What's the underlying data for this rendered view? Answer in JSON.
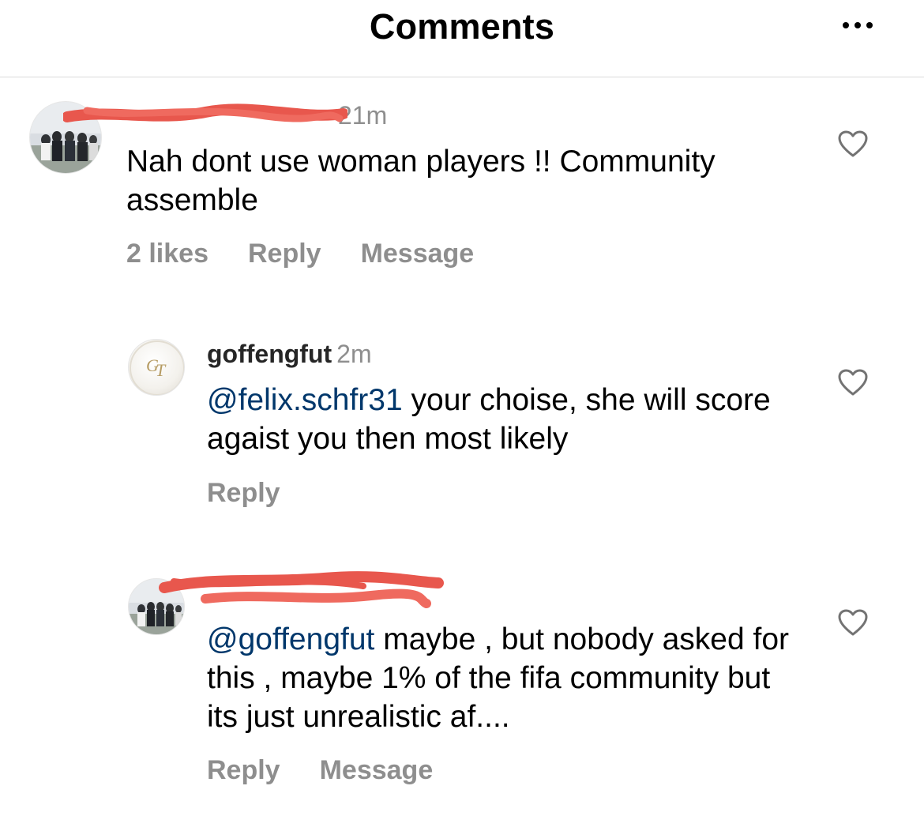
{
  "header": {
    "title": "Comments",
    "more_icon": "more-horizontal-icon"
  },
  "comments": [
    {
      "username": "",
      "time": "21m",
      "text": "Nah dont use woman players !! Community assemble",
      "likes": "2 likes",
      "reply_label": "Reply",
      "message_label": "Message",
      "avatar": "group-photo-avatar",
      "username_redacted": true,
      "redaction_color": "#e8574d"
    },
    {
      "username": "goffengfut",
      "time": "2m",
      "mention": "@felix.schfr31",
      "text": " your choise, she will score agaist you then most likely",
      "reply_label": "Reply",
      "avatar": "gt-logo-avatar"
    },
    {
      "username": "",
      "time": "",
      "mention": "@goffengfut",
      "text": " maybe , but nobody asked for this , maybe 1% of the fifa community but its just unrealistic af....",
      "reply_label": "Reply",
      "message_label": "Message",
      "avatar": "group-photo-avatar",
      "username_redacted": true,
      "redaction_color": "#e8574d"
    }
  ],
  "colors": {
    "mention": "#00376b",
    "secondary_text": "#8e8e8e",
    "divider": "#dbdbdb"
  }
}
